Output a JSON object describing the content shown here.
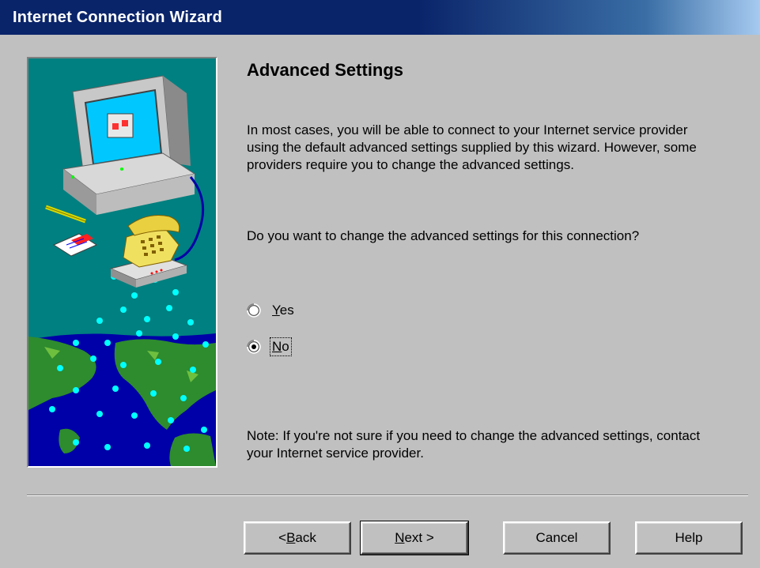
{
  "window": {
    "title": "Internet Connection Wizard"
  },
  "page": {
    "heading": "Advanced Settings",
    "intro": "In most cases, you will be able to connect to your Internet service provider using the default advanced settings supplied by this wizard.  However, some providers require you to change the advanced settings.",
    "question": "Do you want to change the advanced settings for this connection?",
    "note": "Note: If you're not sure if you need to change the advanced settings, contact your Internet service provider."
  },
  "options": {
    "yes": {
      "label": "Yes",
      "accel": "Y",
      "rest": "es",
      "selected": false
    },
    "no": {
      "label": "No",
      "accel": "N",
      "rest": "o",
      "selected": true
    }
  },
  "buttons": {
    "back": {
      "label": "< Back",
      "prefix": "< ",
      "accel": "B",
      "rest": "ack"
    },
    "next": {
      "label": "Next >",
      "accel": "N",
      "rest": "ext >"
    },
    "cancel": {
      "label": "Cancel"
    },
    "help": {
      "label": "Help"
    }
  },
  "colors": {
    "titlebar": "#0a246a",
    "face": "#c0c0c0",
    "illustration_bg": "#008080"
  },
  "icons": {
    "illustration": "computer-telephone-globe-illustration"
  }
}
